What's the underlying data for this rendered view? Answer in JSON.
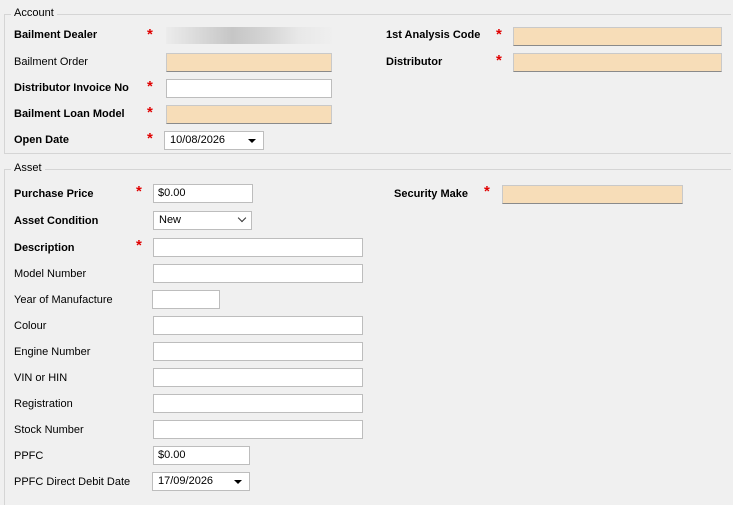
{
  "account": {
    "title": "Account",
    "bailment_dealer": "Bailment Dealer",
    "bailment_order": "Bailment Order",
    "distributor_invoice_no": "Distributor Invoice No",
    "bailment_loan_model": "Bailment Loan Model",
    "open_date": "Open Date",
    "open_date_value": "10/08/2026",
    "first_analysis_code": "1st Analysis Code",
    "distributor": "Distributor"
  },
  "asset": {
    "title": "Asset",
    "purchase_price": "Purchase Price",
    "purchase_price_value": "$0.00",
    "asset_condition": "Asset Condition",
    "asset_condition_value": "New",
    "description": "Description",
    "model_number": "Model Number",
    "year_of_manufacture": "Year of Manufacture",
    "colour": "Colour",
    "engine_number": "Engine Number",
    "vin_or_hin": "VIN or HIN",
    "registration": "Registration",
    "stock_number": "Stock Number",
    "ppfc": "PPFC",
    "ppfc_value": "$0.00",
    "ppfc_direct_debit_date": "PPFC Direct Debit Date",
    "ppfc_direct_debit_date_value": "17/09/2026",
    "security_make": "Security Make"
  },
  "required_marker": "*",
  "colors": {
    "required_field": "#f7ddb8",
    "required_marker": "#e00000",
    "background": "#f0f0f0"
  }
}
